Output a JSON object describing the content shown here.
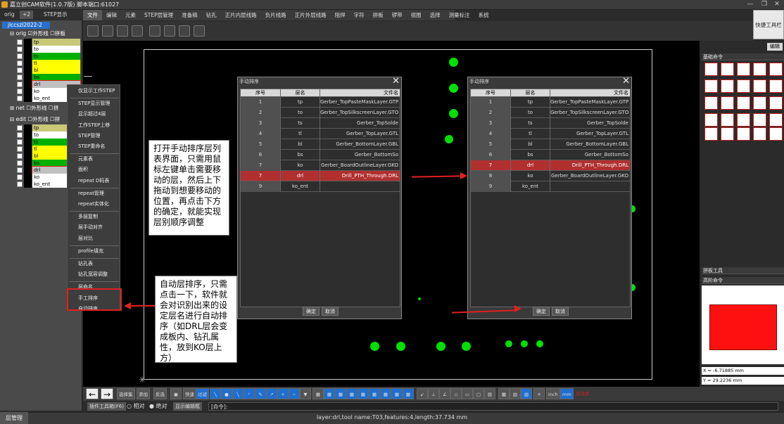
{
  "window": {
    "title": "嘉立创CAM软件(1.0.7版) 脚本端口:61027"
  },
  "left_tabs": [
    "orig",
    "+2",
    "STEP显示"
  ],
  "menu": [
    "文件",
    "编辑",
    "元素",
    "STEP层管理",
    "准备稿",
    "钻孔",
    "正片内层线路",
    "负片线路",
    "正片外层线路",
    "阻焊",
    "字符",
    "拼板",
    "锣带",
    "视图",
    "选择",
    "测量标注",
    "系统"
  ],
  "quick_toolbar": "快捷工具栏",
  "tree": {
    "job": "jlccszl2022-2",
    "orig_group": {
      "name": "orig",
      "opt1": "外形线",
      "opt2": "拼板"
    },
    "net_group": {
      "name": "net",
      "opt1": "外形线",
      "opt2": "拼"
    },
    "edit_group": {
      "name": "edit",
      "opt1": "外形线",
      "opt2": "拼"
    },
    "orig_layers": [
      {
        "name": "tp",
        "color": "#c8c878"
      },
      {
        "name": "to",
        "color": "#ffffff"
      },
      {
        "name": "ts",
        "color": "#00b000"
      },
      {
        "name": "tl",
        "color": "#ffff00"
      },
      {
        "name": "bl",
        "color": "#ffff00"
      },
      {
        "name": "bs",
        "color": "#00b000"
      },
      {
        "name": "drl",
        "color": "#c0c0c0"
      },
      {
        "name": "ko",
        "color": "#ffffff"
      },
      {
        "name": "ko_ent",
        "color": "#ffffff"
      }
    ],
    "edit_layers": [
      {
        "name": "tp",
        "color": "#c8c878"
      },
      {
        "name": "to",
        "color": "#ffffff"
      },
      {
        "name": "ts",
        "color": "#00b000"
      },
      {
        "name": "tl",
        "color": "#ffff00"
      },
      {
        "name": "bl",
        "color": "#ffff00"
      },
      {
        "name": "bs",
        "color": "#00b000"
      },
      {
        "name": "drl",
        "color": "#c0c0c0"
      },
      {
        "name": "ko",
        "color": "#ffffff"
      },
      {
        "name": "ko_ent",
        "color": "#ffffff"
      }
    ]
  },
  "context_menu": [
    "仅显示工作STEP",
    "STEP显示管理",
    "显示超过4层",
    "工作STEP上移",
    "STEP管理",
    "STEP重命名",
    "元素表",
    "面积",
    "repeat D码表",
    "repeat管理",
    "repeat实体化",
    "多层复制",
    "层手动对齐",
    "层对比",
    "profile填充",
    "钻孔表",
    "钻孔宽容调整",
    "层命名",
    "手工排序",
    "自动排序"
  ],
  "callout_manual": "打开手动排序层列表界面，只需用鼠标左键单击需要移动的层，然后上下拖动到想要移动的位置，再点击下方的确定，就能实现层别顺序调整",
  "callout_auto": "自动层排序，只需点击一下，软件就会对识别出来的设定层名进行自动排序（如DRL层会变成板内、钻孔属性，放到KO层上方）",
  "dialog": {
    "title": "手动排序",
    "headers": [
      "序号",
      "层名",
      "文件名"
    ],
    "ok": "确定",
    "cancel": "取消",
    "rows_before": [
      {
        "no": "1",
        "layer": "tp",
        "file": "Gerber_TopPasteMaskLayer.GTP"
      },
      {
        "no": "2",
        "layer": "to",
        "file": "Gerber_TopSilkscreenLayer.GTO"
      },
      {
        "no": "3",
        "layer": "ts",
        "file": "Gerber_TopSolde"
      },
      {
        "no": "4",
        "layer": "tl",
        "file": "Gerber_TopLayer.GTL"
      },
      {
        "no": "5",
        "layer": "bl",
        "file": "Gerber_BottomLayer.GBL"
      },
      {
        "no": "6",
        "layer": "bs",
        "file": "Gerber_BottomSo"
      },
      {
        "no": "7",
        "layer": "ko",
        "file": "Gerber_BoardOutlineLayer.GKO"
      },
      {
        "no": "7",
        "layer": "drl",
        "file": "Drill_PTH_Through.DRL"
      },
      {
        "no": "9",
        "layer": "ko_ent",
        "file": ""
      }
    ],
    "rows_after": [
      {
        "no": "1",
        "layer": "tp",
        "file": "Gerber_TopPasteMaskLayer.GTP"
      },
      {
        "no": "2",
        "layer": "to",
        "file": "Gerber_TopSilkscreenLayer.GTO"
      },
      {
        "no": "3",
        "layer": "ts",
        "file": "Gerber_TopSolde"
      },
      {
        "no": "4",
        "layer": "tl",
        "file": "Gerber_TopLayer.GTL"
      },
      {
        "no": "5",
        "layer": "bl",
        "file": "Gerber_BottomLayer.GBL"
      },
      {
        "no": "6",
        "layer": "bs",
        "file": "Gerber_BottomSo"
      },
      {
        "no": "7",
        "layer": "drl",
        "file": "Drill_PTH_Through.DRL"
      },
      {
        "no": "8",
        "layer": "ko",
        "file": "Gerber_BoardOutlineLayer.GKO"
      },
      {
        "no": "9",
        "layer": "ko_ent",
        "file": ""
      }
    ]
  },
  "right_panel": {
    "edit_tab": "编辑",
    "basic_cmds": "基础命令",
    "panel_tools": "拼板工具",
    "advanced_cmds": "高阶命令",
    "coord_x": "X = -6.71885 mm",
    "coord_y": "Y = 29.2236 mm"
  },
  "bottom_toolbar": {
    "select_all": "选择集",
    "add": "添加",
    "invert": "反选",
    "quick": "快速",
    "filter": "过滤",
    "inch": "inch",
    "mm": "mm",
    "point_snap": "点对点"
  },
  "status_row": {
    "plugin_toolbar": "插件工具箱(F6)",
    "relative": "相对",
    "absolute": "绝对",
    "show_editbar": "显示编辑框",
    "cmd": "[命令]:"
  },
  "bottom_tab": "层管理",
  "status": "layer:drl,tool name:T03,features:4,length:37.734 mm"
}
